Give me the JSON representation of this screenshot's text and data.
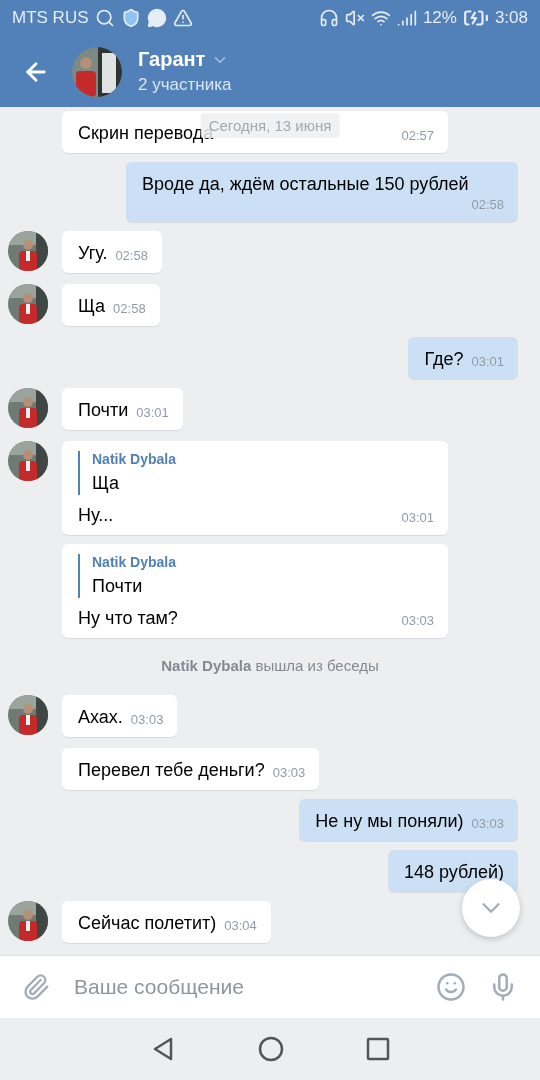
{
  "status_bar": {
    "carrier": "MTS RUS",
    "battery": "12%",
    "time": "3:08"
  },
  "header": {
    "title": "Гарант",
    "subtitle": "2 участника"
  },
  "date_chip": "Сегодня, 13 июня",
  "messages": [
    {
      "kind": "incoming",
      "avatar": false,
      "text": "Скрин перевода",
      "time": "02:57",
      "wide": true
    },
    {
      "kind": "outgoing",
      "text": "Вроде да, ждём остальные 150 рублей",
      "time": "02:58"
    },
    {
      "kind": "incoming",
      "avatar": true,
      "text": "Угу.",
      "time": "02:58"
    },
    {
      "kind": "incoming",
      "avatar": true,
      "text": "Ща",
      "time": "02:58"
    },
    {
      "kind": "outgoing",
      "text": "Где?",
      "time": "03:01"
    },
    {
      "kind": "incoming",
      "avatar": true,
      "text": "Почти",
      "time": "03:01"
    },
    {
      "kind": "reply",
      "avatar": true,
      "quote": {
        "author": "Natik Dybala",
        "text": "Ща"
      },
      "text": "Ну...",
      "time": "03:01"
    },
    {
      "kind": "reply",
      "avatar": false,
      "quote": {
        "author": "Natik Dybala",
        "text": "Почти"
      },
      "text": "Ну что там?",
      "time": "03:03"
    },
    {
      "kind": "system",
      "text": "**Natik Dybala** вышла из беседы"
    },
    {
      "kind": "incoming",
      "avatar": true,
      "text": "Ахах.",
      "time": "03:03"
    },
    {
      "kind": "incoming",
      "avatar": false,
      "text": "Перевел тебе деньги?",
      "time": "03:03"
    },
    {
      "kind": "outgoing",
      "text": "Не ну мы поняли)",
      "time": "03:03"
    },
    {
      "kind": "outgoing",
      "text": "148 рублей)"
    },
    {
      "kind": "incoming",
      "avatar": true,
      "text": "Сейчас полетит)",
      "time": "03:04"
    }
  ],
  "composer": {
    "placeholder": "Ваше сообщение"
  }
}
